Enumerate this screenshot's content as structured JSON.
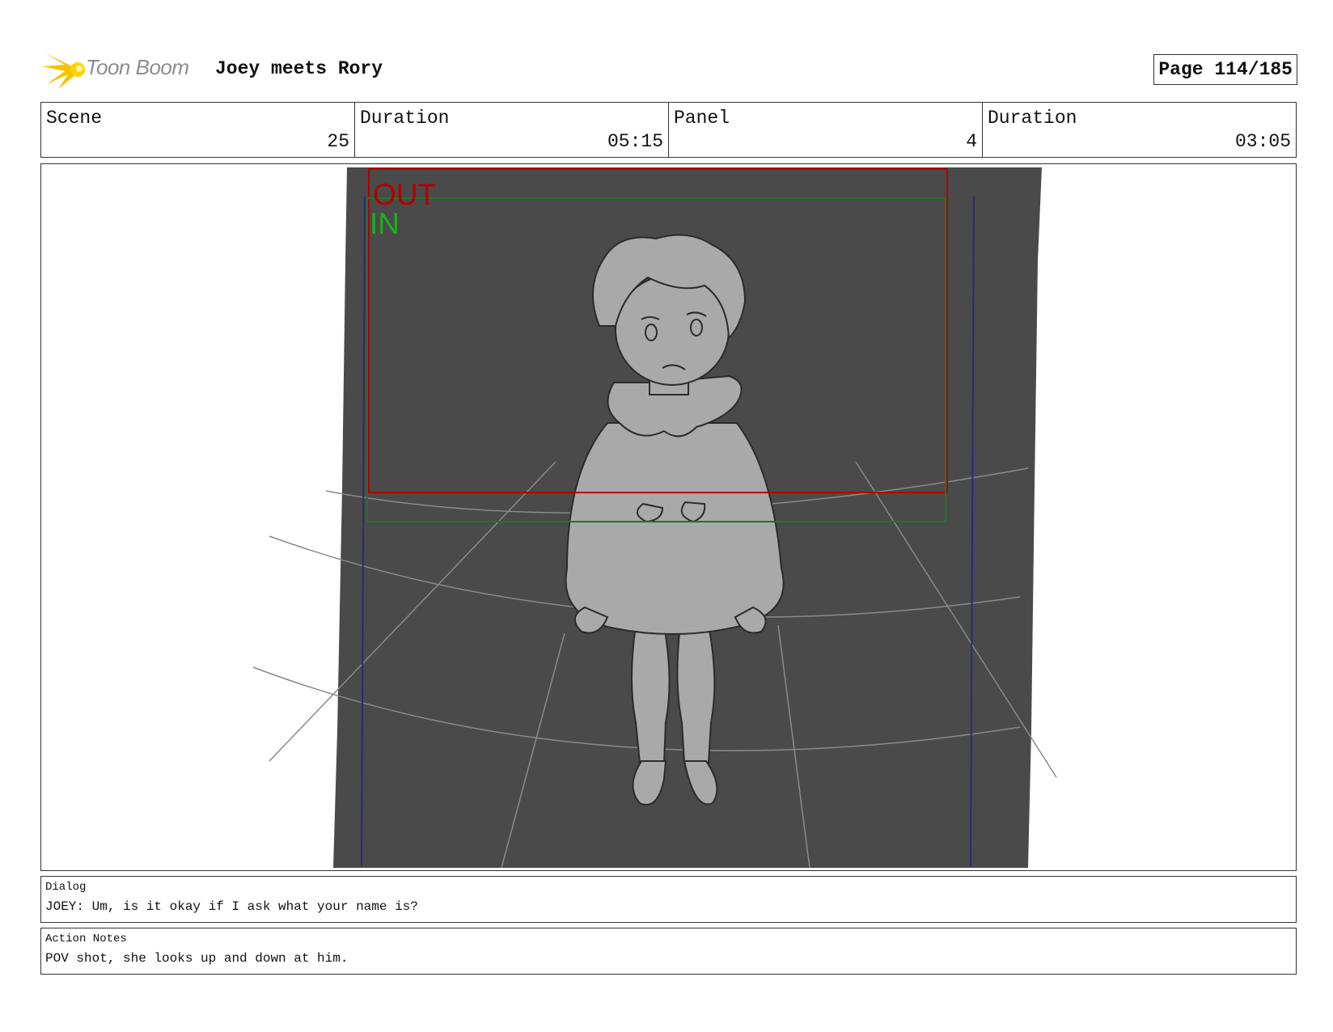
{
  "header": {
    "logo_text": "Toon Boom",
    "project_title": "Joey meets Rory",
    "page": "Page 114/185"
  },
  "info": {
    "scene_label": "Scene",
    "scene_value": "25",
    "scene_duration_label": "Duration",
    "scene_duration_value": "05:15",
    "panel_label": "Panel",
    "panel_value": "4",
    "panel_duration_label": "Duration",
    "panel_duration_value": "03:05"
  },
  "panel": {
    "out_label": "OUT",
    "in_label": "IN",
    "colors": {
      "background": "#4a4a4a",
      "character": "#a9a9a9",
      "out_frame": "#b00000",
      "in_frame": "#1a7a1a",
      "in_text": "#1fae1f",
      "guide_line": "#2a2a7a"
    }
  },
  "dialog": {
    "label": "Dialog",
    "text": "JOEY: Um, is it okay if I ask what your name is?"
  },
  "action_notes": {
    "label": "Action Notes",
    "text": "POV shot, she looks up and down at him."
  }
}
